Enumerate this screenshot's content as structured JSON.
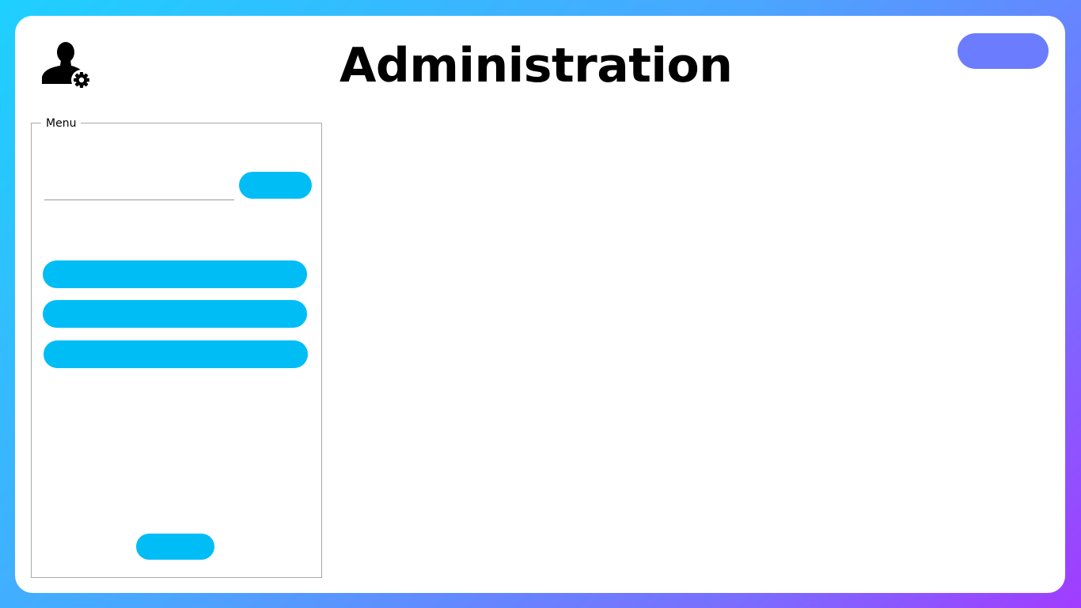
{
  "header": {
    "title": "Administration",
    "icon": "user-gear-icon",
    "top_right_button_label": ""
  },
  "menu": {
    "legend": "Menu",
    "input": {
      "value": "",
      "placeholder": ""
    },
    "input_button_label": "",
    "items": [
      {
        "label": ""
      },
      {
        "label": ""
      },
      {
        "label": ""
      }
    ],
    "bottom_button_label": ""
  },
  "colors": {
    "accent_cyan": "#00bdf5",
    "accent_purple": "#6b7cff",
    "background_gradient_start": "#1ed0ff",
    "background_gradient_end": "#a13cff"
  }
}
